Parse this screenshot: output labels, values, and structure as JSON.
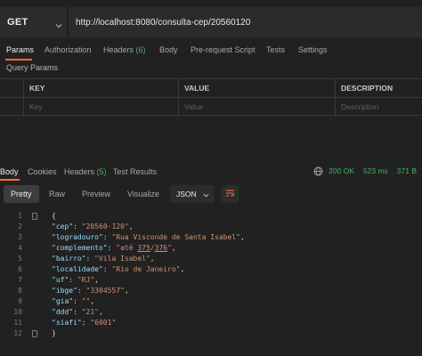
{
  "request": {
    "method": "GET",
    "url": "http://localhost:8080/consulta-cep/20560120"
  },
  "request_tabs": [
    {
      "label": "Params"
    },
    {
      "label": "Authorization"
    },
    {
      "label": "Headers",
      "count": "(6)"
    },
    {
      "label": "Body"
    },
    {
      "label": "Pre-request Script"
    },
    {
      "label": "Tests"
    },
    {
      "label": "Settings"
    }
  ],
  "query_params": {
    "title": "Query Params",
    "headers": [
      "KEY",
      "VALUE",
      "DESCRIPTION"
    ],
    "placeholders": [
      "Key",
      "Value",
      "Description"
    ]
  },
  "response_tabs": [
    {
      "label": "Body"
    },
    {
      "label": "Cookies"
    },
    {
      "label": "Headers",
      "count": "(5)"
    },
    {
      "label": "Test Results"
    }
  ],
  "response_status": {
    "status": "200 OK",
    "time": "523 ms",
    "size": "371 B"
  },
  "view_modes": [
    "Pretty",
    "Raw",
    "Preview",
    "Visualize"
  ],
  "format": "JSON",
  "body": {
    "line_numbers": [
      "1",
      "2",
      "3",
      "4",
      "5",
      "6",
      "7",
      "8",
      "9",
      "10",
      "11",
      "12"
    ],
    "open": "{",
    "close": "}",
    "fields": [
      {
        "key": "\"cep\"",
        "value": "\"20560-120\""
      },
      {
        "key": "\"logradouro\"",
        "value": "\"Rua Visconde de Santa Isabel\""
      },
      {
        "key": "\"complemento\"",
        "value_before": "\"até ",
        "value_u1": "375",
        "value_slash": "/",
        "value_u2": "376",
        "value_after": "\""
      },
      {
        "key": "\"bairro\"",
        "value": "\"Vila Isabel\""
      },
      {
        "key": "\"localidade\"",
        "value": "\"Rio de Janeiro\""
      },
      {
        "key": "\"uf\"",
        "value": "\"RJ\""
      },
      {
        "key": "\"ibge\"",
        "value": "\"3304557\""
      },
      {
        "key": "\"gia\"",
        "value": "\"\""
      },
      {
        "key": "\"ddd\"",
        "value": "\"21\""
      },
      {
        "key": "\"siafi\"",
        "value": "\"6001\""
      }
    ]
  },
  "colors": {
    "accent": "#ff6c37",
    "success": "#4cae5b",
    "json_key": "#9cdcfe",
    "json_string": "#ce9178"
  }
}
